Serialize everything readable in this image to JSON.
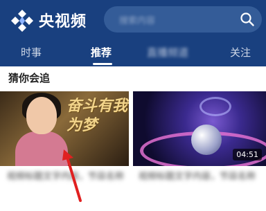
{
  "header": {
    "app_title": "央视频",
    "search_placeholder": "搜索内容"
  },
  "tabs": [
    {
      "label": "时事",
      "active": false
    },
    {
      "label": "推荐",
      "active": true
    },
    {
      "label": "直播频道",
      "active": false
    },
    {
      "label": "关注",
      "active": false
    }
  ],
  "section": {
    "title": "猜你会追"
  },
  "cards": [
    {
      "overlay_text": "奋斗有我 为梦",
      "caption": "视频标题文字内容，节目名称"
    },
    {
      "duration": "04:51",
      "caption": "视频标题文字内容，节目名称"
    }
  ],
  "colors": {
    "header_bg": "#19407f",
    "search_bg": "#345c98",
    "annotation_arrow": "#e02020"
  }
}
